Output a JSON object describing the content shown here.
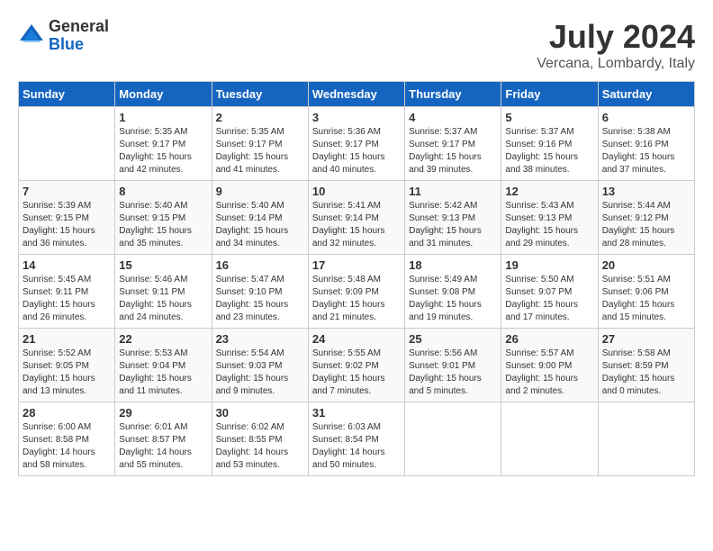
{
  "header": {
    "logo_general": "General",
    "logo_blue": "Blue",
    "month_year": "July 2024",
    "location": "Vercana, Lombardy, Italy"
  },
  "calendar": {
    "days_of_week": [
      "Sunday",
      "Monday",
      "Tuesday",
      "Wednesday",
      "Thursday",
      "Friday",
      "Saturday"
    ],
    "weeks": [
      [
        {
          "day": "",
          "sunrise": "",
          "sunset": "",
          "daylight": ""
        },
        {
          "day": "1",
          "sunrise": "Sunrise: 5:35 AM",
          "sunset": "Sunset: 9:17 PM",
          "daylight": "Daylight: 15 hours and 42 minutes."
        },
        {
          "day": "2",
          "sunrise": "Sunrise: 5:35 AM",
          "sunset": "Sunset: 9:17 PM",
          "daylight": "Daylight: 15 hours and 41 minutes."
        },
        {
          "day": "3",
          "sunrise": "Sunrise: 5:36 AM",
          "sunset": "Sunset: 9:17 PM",
          "daylight": "Daylight: 15 hours and 40 minutes."
        },
        {
          "day": "4",
          "sunrise": "Sunrise: 5:37 AM",
          "sunset": "Sunset: 9:17 PM",
          "daylight": "Daylight: 15 hours and 39 minutes."
        },
        {
          "day": "5",
          "sunrise": "Sunrise: 5:37 AM",
          "sunset": "Sunset: 9:16 PM",
          "daylight": "Daylight: 15 hours and 38 minutes."
        },
        {
          "day": "6",
          "sunrise": "Sunrise: 5:38 AM",
          "sunset": "Sunset: 9:16 PM",
          "daylight": "Daylight: 15 hours and 37 minutes."
        }
      ],
      [
        {
          "day": "7",
          "sunrise": "Sunrise: 5:39 AM",
          "sunset": "Sunset: 9:15 PM",
          "daylight": "Daylight: 15 hours and 36 minutes."
        },
        {
          "day": "8",
          "sunrise": "Sunrise: 5:40 AM",
          "sunset": "Sunset: 9:15 PM",
          "daylight": "Daylight: 15 hours and 35 minutes."
        },
        {
          "day": "9",
          "sunrise": "Sunrise: 5:40 AM",
          "sunset": "Sunset: 9:14 PM",
          "daylight": "Daylight: 15 hours and 34 minutes."
        },
        {
          "day": "10",
          "sunrise": "Sunrise: 5:41 AM",
          "sunset": "Sunset: 9:14 PM",
          "daylight": "Daylight: 15 hours and 32 minutes."
        },
        {
          "day": "11",
          "sunrise": "Sunrise: 5:42 AM",
          "sunset": "Sunset: 9:13 PM",
          "daylight": "Daylight: 15 hours and 31 minutes."
        },
        {
          "day": "12",
          "sunrise": "Sunrise: 5:43 AM",
          "sunset": "Sunset: 9:13 PM",
          "daylight": "Daylight: 15 hours and 29 minutes."
        },
        {
          "day": "13",
          "sunrise": "Sunrise: 5:44 AM",
          "sunset": "Sunset: 9:12 PM",
          "daylight": "Daylight: 15 hours and 28 minutes."
        }
      ],
      [
        {
          "day": "14",
          "sunrise": "Sunrise: 5:45 AM",
          "sunset": "Sunset: 9:11 PM",
          "daylight": "Daylight: 15 hours and 26 minutes."
        },
        {
          "day": "15",
          "sunrise": "Sunrise: 5:46 AM",
          "sunset": "Sunset: 9:11 PM",
          "daylight": "Daylight: 15 hours and 24 minutes."
        },
        {
          "day": "16",
          "sunrise": "Sunrise: 5:47 AM",
          "sunset": "Sunset: 9:10 PM",
          "daylight": "Daylight: 15 hours and 23 minutes."
        },
        {
          "day": "17",
          "sunrise": "Sunrise: 5:48 AM",
          "sunset": "Sunset: 9:09 PM",
          "daylight": "Daylight: 15 hours and 21 minutes."
        },
        {
          "day": "18",
          "sunrise": "Sunrise: 5:49 AM",
          "sunset": "Sunset: 9:08 PM",
          "daylight": "Daylight: 15 hours and 19 minutes."
        },
        {
          "day": "19",
          "sunrise": "Sunrise: 5:50 AM",
          "sunset": "Sunset: 9:07 PM",
          "daylight": "Daylight: 15 hours and 17 minutes."
        },
        {
          "day": "20",
          "sunrise": "Sunrise: 5:51 AM",
          "sunset": "Sunset: 9:06 PM",
          "daylight": "Daylight: 15 hours and 15 minutes."
        }
      ],
      [
        {
          "day": "21",
          "sunrise": "Sunrise: 5:52 AM",
          "sunset": "Sunset: 9:05 PM",
          "daylight": "Daylight: 15 hours and 13 minutes."
        },
        {
          "day": "22",
          "sunrise": "Sunrise: 5:53 AM",
          "sunset": "Sunset: 9:04 PM",
          "daylight": "Daylight: 15 hours and 11 minutes."
        },
        {
          "day": "23",
          "sunrise": "Sunrise: 5:54 AM",
          "sunset": "Sunset: 9:03 PM",
          "daylight": "Daylight: 15 hours and 9 minutes."
        },
        {
          "day": "24",
          "sunrise": "Sunrise: 5:55 AM",
          "sunset": "Sunset: 9:02 PM",
          "daylight": "Daylight: 15 hours and 7 minutes."
        },
        {
          "day": "25",
          "sunrise": "Sunrise: 5:56 AM",
          "sunset": "Sunset: 9:01 PM",
          "daylight": "Daylight: 15 hours and 5 minutes."
        },
        {
          "day": "26",
          "sunrise": "Sunrise: 5:57 AM",
          "sunset": "Sunset: 9:00 PM",
          "daylight": "Daylight: 15 hours and 2 minutes."
        },
        {
          "day": "27",
          "sunrise": "Sunrise: 5:58 AM",
          "sunset": "Sunset: 8:59 PM",
          "daylight": "Daylight: 15 hours and 0 minutes."
        }
      ],
      [
        {
          "day": "28",
          "sunrise": "Sunrise: 6:00 AM",
          "sunset": "Sunset: 8:58 PM",
          "daylight": "Daylight: 14 hours and 58 minutes."
        },
        {
          "day": "29",
          "sunrise": "Sunrise: 6:01 AM",
          "sunset": "Sunset: 8:57 PM",
          "daylight": "Daylight: 14 hours and 55 minutes."
        },
        {
          "day": "30",
          "sunrise": "Sunrise: 6:02 AM",
          "sunset": "Sunset: 8:55 PM",
          "daylight": "Daylight: 14 hours and 53 minutes."
        },
        {
          "day": "31",
          "sunrise": "Sunrise: 6:03 AM",
          "sunset": "Sunset: 8:54 PM",
          "daylight": "Daylight: 14 hours and 50 minutes."
        },
        {
          "day": "",
          "sunrise": "",
          "sunset": "",
          "daylight": ""
        },
        {
          "day": "",
          "sunrise": "",
          "sunset": "",
          "daylight": ""
        },
        {
          "day": "",
          "sunrise": "",
          "sunset": "",
          "daylight": ""
        }
      ]
    ]
  }
}
